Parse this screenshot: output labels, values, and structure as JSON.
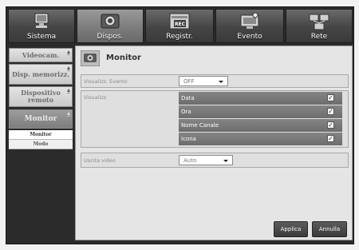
{
  "tabs": [
    {
      "label": "Sistema",
      "active": false,
      "icon": "monitor-icon"
    },
    {
      "label": "Dispos.",
      "active": true,
      "icon": "camera-icon"
    },
    {
      "label": "Registr.",
      "active": false,
      "icon": "rec-icon"
    },
    {
      "label": "Evento",
      "active": false,
      "icon": "event-icon"
    },
    {
      "label": "Rete",
      "active": false,
      "icon": "network-icon"
    }
  ],
  "sidebar": {
    "items": [
      {
        "label": "Videocam."
      },
      {
        "label": "Disp. memorizz."
      },
      {
        "label": "Dispositivo remoto"
      },
      {
        "label": "Monitor"
      }
    ],
    "subitems": [
      {
        "label": "Monitor",
        "active": true
      },
      {
        "label": "Modo",
        "active": false
      }
    ]
  },
  "panel": {
    "title": "Monitor",
    "event_display": {
      "label": "Visualizz. Evento",
      "value": "OFF"
    },
    "display": {
      "label": "Visualizz",
      "options": [
        {
          "label": "Data",
          "checked": true
        },
        {
          "label": "Ora",
          "checked": true
        },
        {
          "label": "Nome Canale",
          "checked": true
        },
        {
          "label": "Icona",
          "checked": true
        }
      ]
    },
    "video_output": {
      "label": "Uscita video",
      "value": "Auto"
    },
    "apply_label": "Applica",
    "cancel_label": "Annulla"
  },
  "check_glyph": "✓"
}
